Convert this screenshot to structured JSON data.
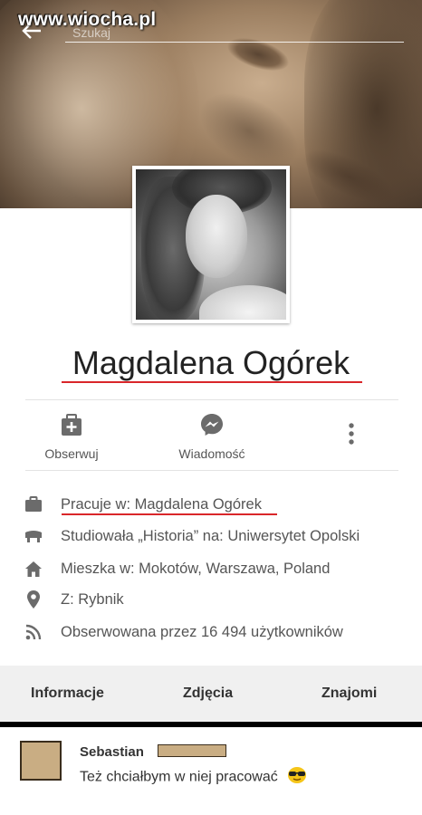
{
  "watermark": "www.wiocha.pl",
  "search": {
    "placeholder": "Szukaj"
  },
  "profile": {
    "name": "Magdalena Ogórek"
  },
  "actions": {
    "follow": "Obserwuj",
    "message": "Wiadomość"
  },
  "info": [
    {
      "icon": "briefcase-icon",
      "text": "Pracuje w: Magdalena Ogórek"
    },
    {
      "icon": "graduation-cap-icon",
      "text": "Studiowała „Historia”  na: Uniwersytet Opolski"
    },
    {
      "icon": "home-icon",
      "text": "Mieszka w: Mokotów, Warszawa, Poland"
    },
    {
      "icon": "location-pin-icon",
      "text": "Z: Rybnik"
    },
    {
      "icon": "rss-icon",
      "text": "Obserwowana przez 16 494 użytkowników"
    }
  ],
  "tabs": [
    "Informacje",
    "Zdjęcia",
    "Znajomi"
  ],
  "comment": {
    "author": "Sebastian",
    "text": "Też chciałbym w niej pracować"
  },
  "colors": {
    "accent_underline": "#d9262a",
    "icon_gray": "#6b6b6b",
    "tab_bg": "#f0f0f0"
  }
}
